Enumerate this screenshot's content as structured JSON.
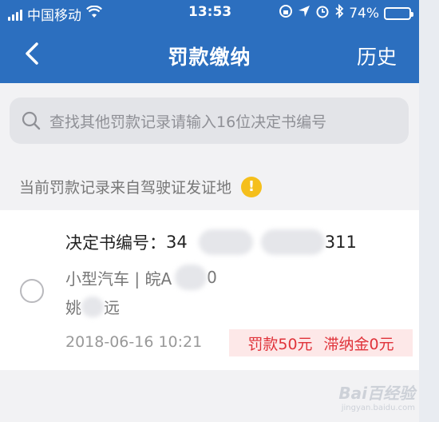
{
  "status_bar": {
    "carrier": "中国移动",
    "time": "13:53",
    "battery": "74%",
    "battery_level": 0.74
  },
  "header": {
    "title": "罚款缴纳",
    "history": "历史"
  },
  "search": {
    "placeholder": "查找其他罚款记录请输入16位决定书编号"
  },
  "notice": {
    "text": "当前罚款记录来自驾驶证发证地",
    "icon_glyph": "!"
  },
  "record": {
    "decision_label": "决定书编号：",
    "decision_start": "34",
    "decision_end": "311",
    "vehicle_type": "小型汽车 | 皖A",
    "plate_end": "0",
    "person_first": "姚",
    "person_last": "远",
    "date": "2018-06-16 10:21",
    "fine": "罚款50元",
    "late_fee": "滞纳金0元"
  },
  "watermark": {
    "text": "Bai百经验",
    "sub": "jingyan.baidu.com"
  },
  "colors": {
    "brand": "#2c6fbf",
    "warn": "#f5bf1c",
    "fine_text": "#e0333a",
    "fine_bg": "#fde8e8"
  }
}
